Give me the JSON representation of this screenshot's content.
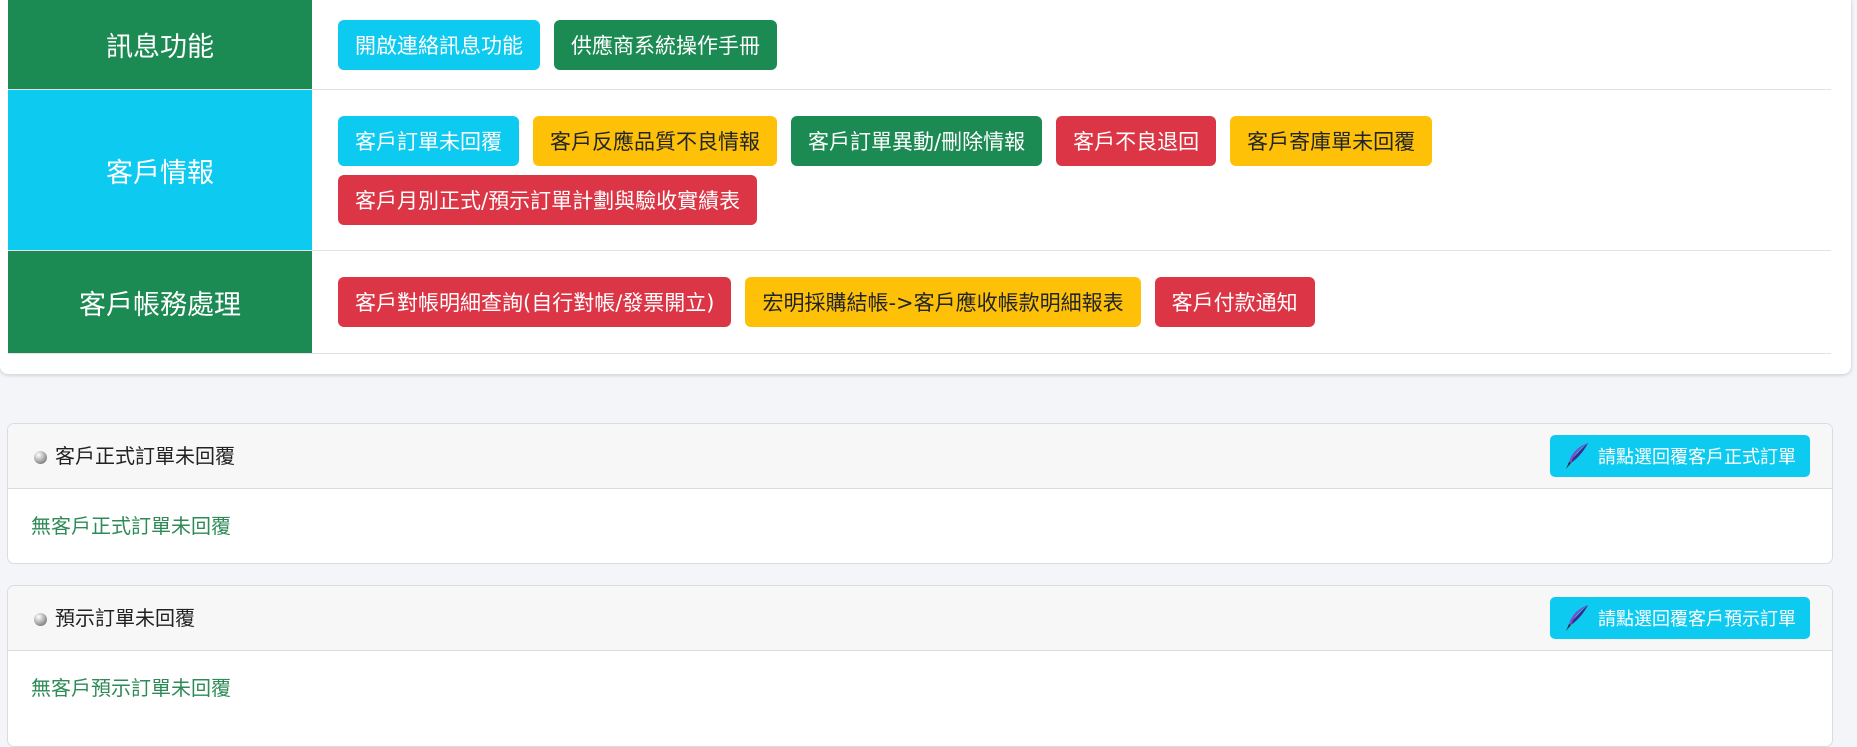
{
  "colors": {
    "green": "#1c8a53",
    "cyan": "#0dcaf0",
    "yellow": "#ffc107",
    "red": "#dc3545",
    "msg_green": "#2e8b57"
  },
  "sections": [
    {
      "label": "訊息功能",
      "color": "#1c8a53",
      "buttons": [
        {
          "label": "開啟連絡訊息功能",
          "bg": "#0dcaf0",
          "fg": "#ffffff"
        },
        {
          "label": "供應商系統操作手冊",
          "bg": "#1c8a53",
          "fg": "#ffffff"
        }
      ]
    },
    {
      "label": "客戶情報",
      "color": "#0dcaf0",
      "buttons": [
        {
          "label": "客戶訂單未回覆",
          "bg": "#0dcaf0",
          "fg": "#ffffff"
        },
        {
          "label": "客戶反應品質不良情報",
          "bg": "#ffc107",
          "fg": "#212529"
        },
        {
          "label": "客戶訂單異動/刪除情報",
          "bg": "#1c8a53",
          "fg": "#ffffff"
        },
        {
          "label": "客戶不良退回",
          "bg": "#dc3545",
          "fg": "#ffffff"
        },
        {
          "label": "客戶寄庫單未回覆",
          "bg": "#ffc107",
          "fg": "#212529"
        },
        {
          "label": "客戶月別正式/預示訂單計劃與驗收實績表",
          "bg": "#dc3545",
          "fg": "#ffffff"
        }
      ]
    },
    {
      "label": "客戶帳務處理",
      "color": "#1c8a53",
      "buttons": [
        {
          "label": "客戶對帳明細查詢(自行對帳/發票開立)",
          "bg": "#dc3545",
          "fg": "#ffffff"
        },
        {
          "label": "宏明採購結帳->客戶應收帳款明細報表",
          "bg": "#ffc107",
          "fg": "#212529"
        },
        {
          "label": "客戶付款通知",
          "bg": "#dc3545",
          "fg": "#ffffff"
        }
      ]
    }
  ],
  "panels": [
    {
      "title": "客戶正式訂單未回覆",
      "button_label": "請點選回覆客戶正式訂單",
      "button_icon": "quill-pen-icon",
      "message": "無客戶正式訂單未回覆"
    },
    {
      "title": "預示訂單未回覆",
      "button_label": "請點選回覆客戶預示訂單",
      "button_icon": "quill-pen-icon",
      "message": "無客戶預示訂單未回覆"
    }
  ]
}
